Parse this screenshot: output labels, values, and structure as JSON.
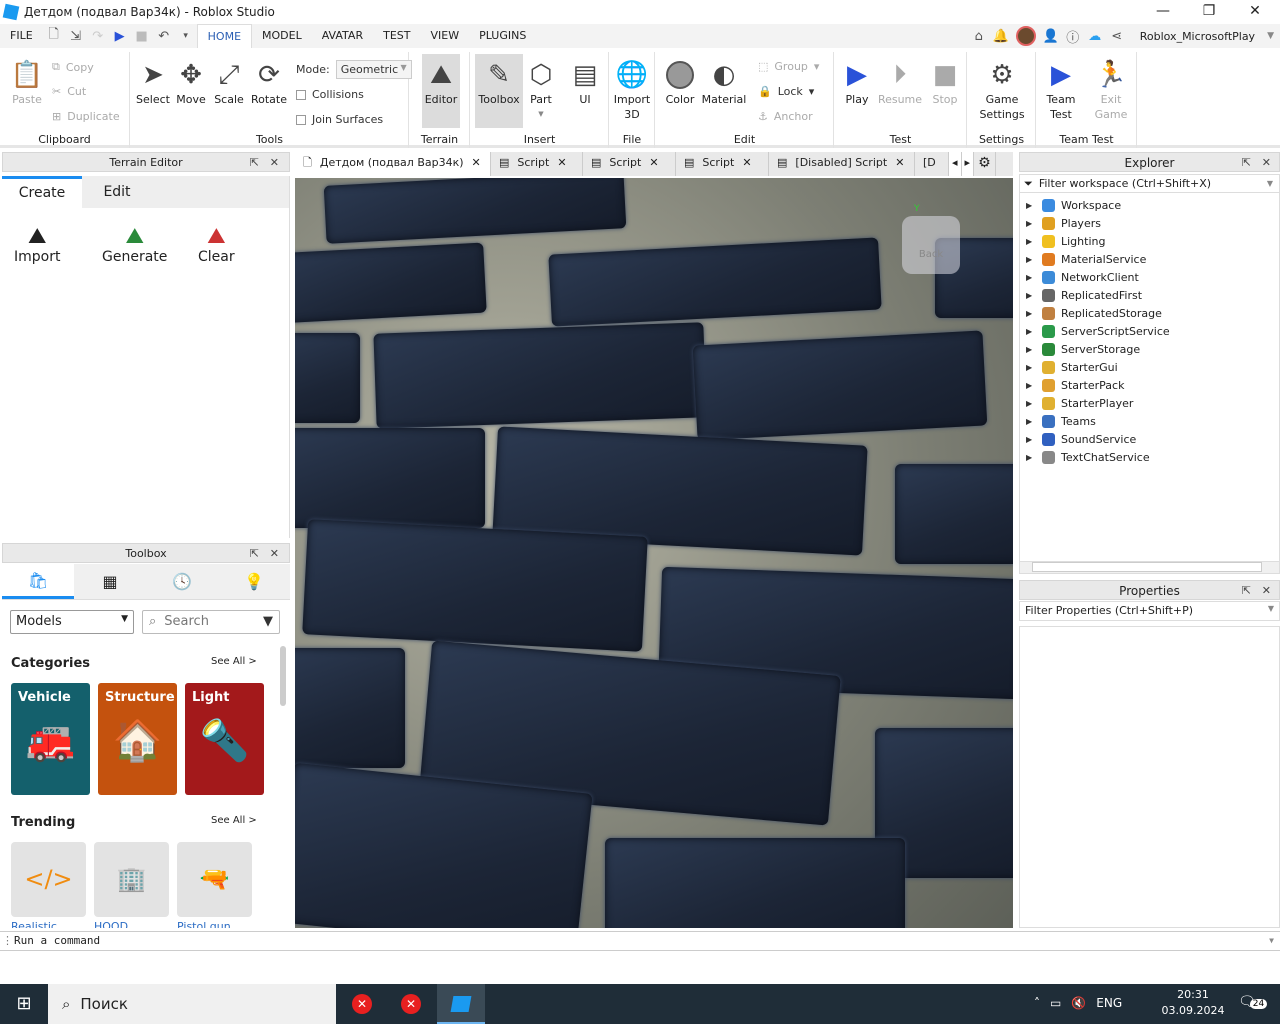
{
  "window": {
    "title": "Детдом (подвал Вар34к)  - Roblox Studio"
  },
  "menu": {
    "file": "FILE",
    "tabs": [
      "HOME",
      "MODEL",
      "AVATAR",
      "TEST",
      "VIEW",
      "PLUGINS"
    ],
    "user": "Roblox_MicrosoftPlay"
  },
  "ribbon": {
    "clipboard": {
      "paste": "Paste",
      "copy": "Copy",
      "cut": "Cut",
      "duplicate": "Duplicate",
      "label": "Clipboard"
    },
    "tools": {
      "select": "Select",
      "move": "Move",
      "scale": "Scale",
      "rotate": "Rotate",
      "mode_label": "Mode:",
      "mode_value": "Geometric",
      "collisions": "Collisions",
      "join_surfaces": "Join Surfaces",
      "label": "Tools"
    },
    "terrain": {
      "editor": "Editor",
      "label": "Terrain"
    },
    "insert": {
      "toolbox": "Toolbox",
      "part": "Part",
      "ui": "UI",
      "label": "Insert"
    },
    "file": {
      "import3d": "Import 3D",
      "label": "File"
    },
    "edit": {
      "color": "Color",
      "material": "Material",
      "group": "Group",
      "lock": "Lock",
      "anchor": "Anchor",
      "label": "Edit"
    },
    "test": {
      "play": "Play",
      "resume": "Resume",
      "stop": "Stop",
      "label": "Test"
    },
    "settings": {
      "game_settings": "Game Settings",
      "label": "Settings"
    },
    "team_test": {
      "team_test": "Team Test",
      "exit_game": "Exit Game",
      "label": "Team Test"
    }
  },
  "terrain_editor": {
    "title": "Terrain Editor",
    "tabs": [
      "Create",
      "Edit"
    ],
    "tools": [
      "Import",
      "Generate",
      "Clear"
    ]
  },
  "toolbox": {
    "title": "Toolbox",
    "category_select": "Models",
    "search_placeholder": "Search",
    "categories_title": "Categories",
    "see_all": "See All >",
    "categories": [
      "Vehicle",
      "Structure",
      "Light"
    ],
    "trending_title": "Trending",
    "trending": [
      "Realistic",
      "HOOD",
      "Pistol gun"
    ]
  },
  "doc_tabs": [
    "Детдом (подвал Вар34к)",
    "Script",
    "Script",
    "Script",
    "[Disabled] Script",
    "[D"
  ],
  "viewcube": {
    "face": "Back",
    "axis_y": "Y"
  },
  "explorer": {
    "title": "Explorer",
    "filter": "Filter workspace (Ctrl+Shift+X)",
    "items": [
      "Workspace",
      "Players",
      "Lighting",
      "MaterialService",
      "NetworkClient",
      "ReplicatedFirst",
      "ReplicatedStorage",
      "ServerScriptService",
      "ServerStorage",
      "StarterGui",
      "StarterPack",
      "StarterPlayer",
      "Teams",
      "SoundService",
      "TextChatService"
    ]
  },
  "properties": {
    "title": "Properties",
    "filter": "Filter Properties (Ctrl+Shift+P)"
  },
  "command_bar": {
    "placeholder": "Run a command"
  },
  "taskbar": {
    "search": "Поиск",
    "lang": "ENG",
    "time": "20:31",
    "date": "03.09.2024",
    "notifications": "24"
  },
  "colors": {
    "accent": "#2b5fb4",
    "play": "#2a52d8",
    "taskbar": "#1f2d38"
  }
}
